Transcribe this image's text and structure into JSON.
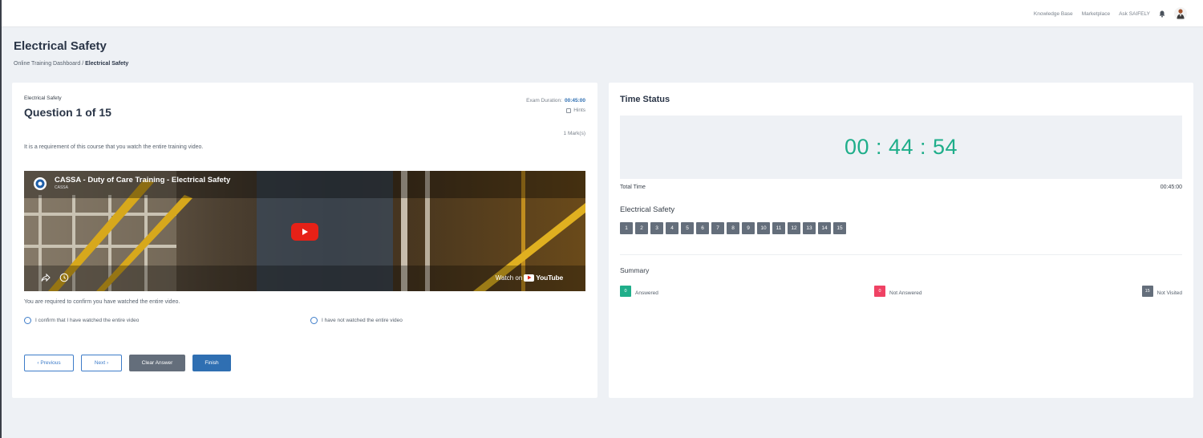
{
  "header": {
    "nav": [
      "Knowledge Base",
      "Marketplace",
      "Ask SAIFELY"
    ]
  },
  "page": {
    "title": "Electrical Safety",
    "breadcrumb": {
      "root": "Online Training Dashboard",
      "separator": "/",
      "current": "Electrical Safety"
    }
  },
  "question": {
    "course": "Electrical Safety",
    "title": "Question 1 of 15",
    "exam_duration_label": "Exam Duration:",
    "exam_duration_value": "00:45:00",
    "hints_label": "Hints",
    "marks": "1 Mark(s)",
    "text": "It is a requirement of this course that you watch the entire training video.",
    "confirm_prompt": "You are required to confirm you have watched the entire video.",
    "options": [
      "I confirm that I have watched the entire video",
      "I have not watched the entire video"
    ]
  },
  "video": {
    "title": "CASSA - Duty of Care Training - Electrical Safety",
    "channel": "CASSA",
    "watch_on": "Watch on",
    "youtube": "YouTube",
    "accent": "#e62117"
  },
  "buttons": {
    "previous": "‹ Previous",
    "next": "Next ›",
    "clear": "Clear Answer",
    "finish": "Finish"
  },
  "time_status": {
    "title": "Time Status",
    "timer": "00 : 44 : 54",
    "total_time_label": "Total Time",
    "total_time_value": "00:45:00",
    "section_title": "Electrical Safety",
    "question_numbers": [
      "1",
      "2",
      "3",
      "4",
      "5",
      "6",
      "7",
      "8",
      "9",
      "10",
      "11",
      "12",
      "13",
      "14",
      "15"
    ]
  },
  "summary": {
    "title": "Summary",
    "answered": {
      "count": "0",
      "label": "Answered",
      "color": "#1fae8a"
    },
    "not_answered": {
      "count": "0",
      "label": "Not Answered",
      "color": "#ef4264"
    },
    "not_visited": {
      "count": "15",
      "label": "Not Visited",
      "color": "#646e7b"
    }
  }
}
